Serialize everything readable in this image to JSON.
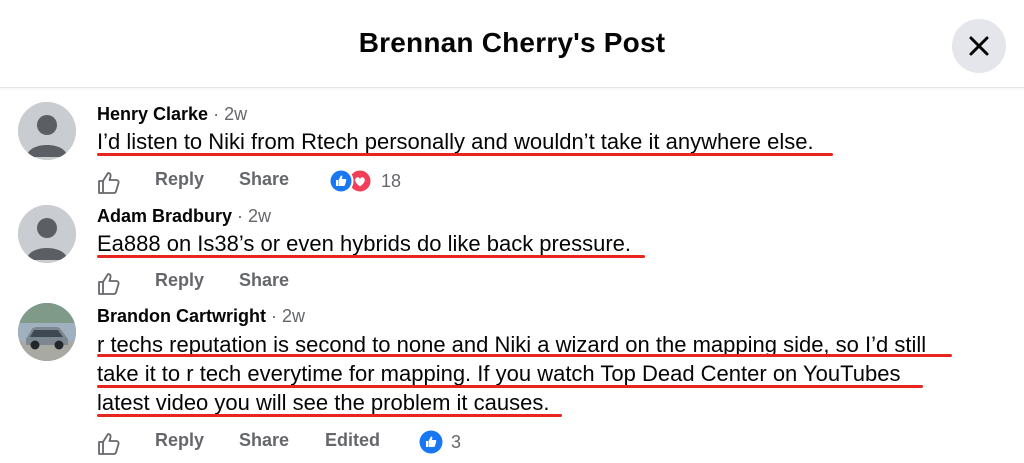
{
  "header": {
    "title": "Brennan Cherry's Post",
    "close_icon": "close-icon"
  },
  "comments": [
    {
      "author": "Henry Clarke",
      "time": "2w",
      "lines": [
        "I’d listen to Niki from Rtech personally and wouldn’t take it anywhere else."
      ],
      "actions": {
        "reply": "Reply",
        "share": "Share"
      },
      "reactions": {
        "types": [
          "like",
          "love"
        ],
        "count": "18"
      }
    },
    {
      "author": "Adam Bradbury",
      "time": "2w",
      "lines": [
        "Ea888 on Is38’s or even hybrids do like back pressure."
      ],
      "actions": {
        "reply": "Reply",
        "share": "Share"
      }
    },
    {
      "author": "Brandon Cartwright",
      "time": "2w",
      "lines": [
        "r techs reputation is second to none and Niki a wizard on the mapping side, so I’d still",
        "take it to r tech everytime for mapping. If you watch Top Dead Center on YouTubes",
        "latest video you will see the problem it causes."
      ],
      "actions": {
        "reply": "Reply",
        "share": "Share",
        "edited": "Edited"
      },
      "reactions": {
        "types": [
          "like"
        ],
        "count": "3"
      }
    }
  ],
  "colors": {
    "underline": "#e8251f",
    "like_blue": "#1877f2",
    "love_red": "#f33e58",
    "muted": "#65676b"
  }
}
